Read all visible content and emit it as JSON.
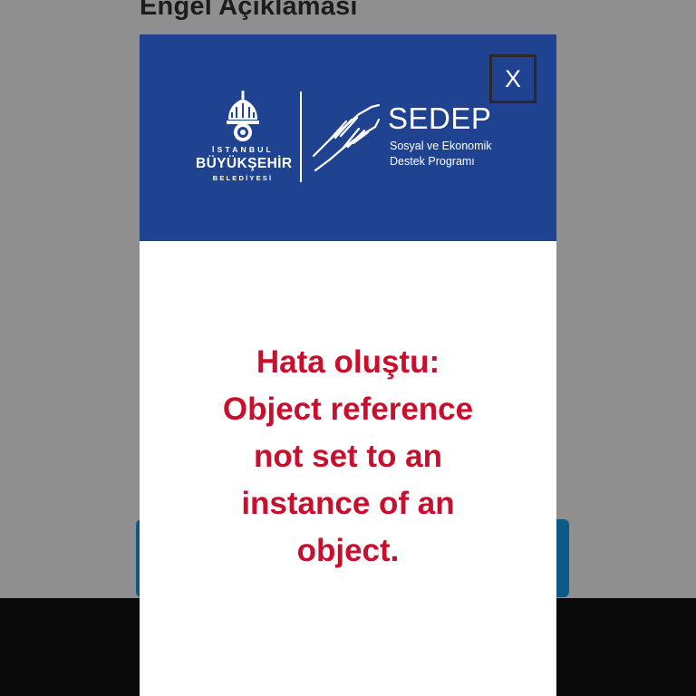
{
  "background_page": {
    "title": "Engel Açıklaması"
  },
  "modal": {
    "close_label": "X",
    "logos": {
      "ibb": {
        "line1": "İSTANBUL",
        "line2": "BÜYÜKŞEHİR",
        "line3": "BELEDİYESİ"
      },
      "sedep": {
        "title": "SEDEP",
        "subtitle_line1": "Sosyal ve Ekonomik",
        "subtitle_line2": "Destek Programı"
      }
    },
    "error_message": "Hata oluştu: Object reference not set to an instance of an object."
  },
  "colors": {
    "modal_header": "#1f4391",
    "error_text": "#c8102e",
    "overlay": "#8f8f8f",
    "underlay_button": "#0e5a86"
  },
  "icons": [
    "ibb-emblem-icon",
    "helping-hands-icon",
    "close-icon"
  ]
}
